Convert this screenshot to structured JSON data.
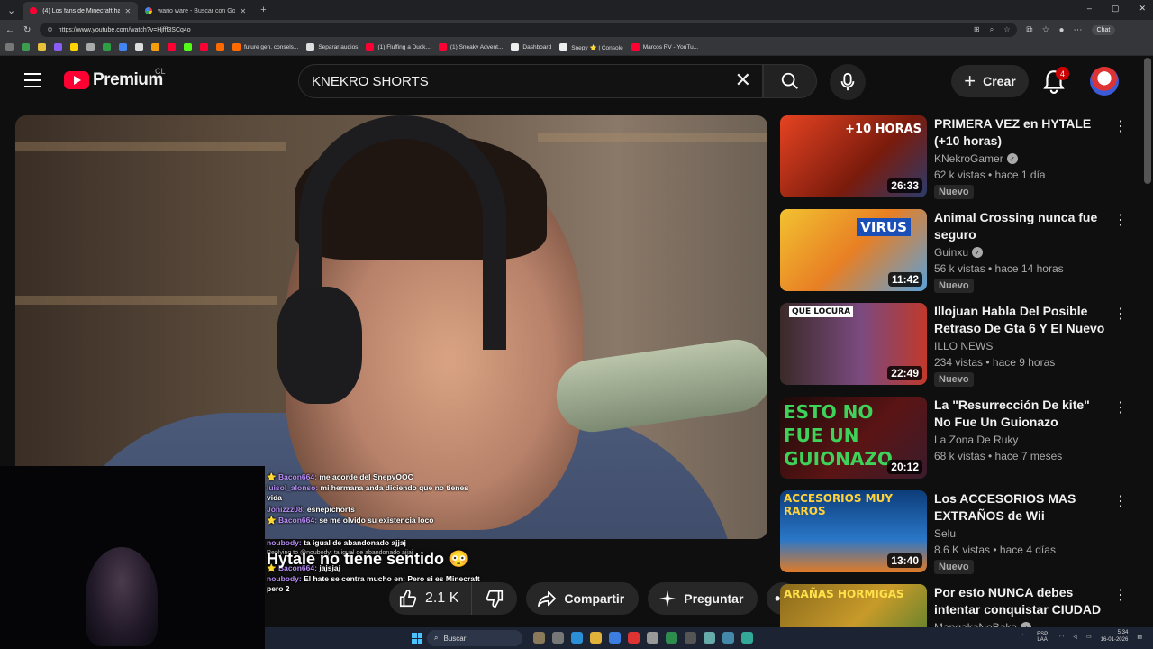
{
  "browser": {
    "tabs": [
      {
        "title": "(4) Los fans de Minecraft hateando",
        "active": true
      },
      {
        "title": "wario ware - Buscar con Google",
        "active": false
      }
    ],
    "url": "https://www.youtube.com/watch?v=Hjfff3SCq4o",
    "chat_label": "Chat",
    "bookmarks": [
      "future gen. consels...",
      "Separar audios",
      "(1) Fluffing a Duck...",
      "(1) Sneaky Advent...",
      "Dashboard",
      "Snepy ⭐ | Console",
      "Marcos RV - YouTu..."
    ]
  },
  "header": {
    "logo_text": "Premium",
    "country": "CL",
    "search_value": "KNEKRO SHORTS",
    "create_label": "Crear",
    "notification_count": "4"
  },
  "video": {
    "title": "Hytale no tiene sentido 😳",
    "like_count": "2.1 K",
    "share_label": "Compartir",
    "ask_label": "Preguntar"
  },
  "chat": [
    {
      "user": "Bacon664:",
      "text": "me acorde del SnepyOOC"
    },
    {
      "user": "luisol_alonso:",
      "text": "mi hermana anda diciendo que no tienes vida"
    },
    {
      "user": "Jonizzz08:",
      "text": "esnepichorts"
    },
    {
      "user": "Bacon664:",
      "text": "se me olvido su existencia loco"
    },
    {
      "user": "noubody:",
      "text": "ta igual de abandonado ajjaj"
    },
    {
      "user": "Replying to @noubody:",
      "text": "ta igual de abandonado ajjaj"
    },
    {
      "user": "Bacon664:",
      "text": "jajsjaj"
    },
    {
      "user": "noubody:",
      "text": "El hate se centra mucho en: Pero si es Minecraft pero 2"
    }
  ],
  "recommendations": [
    {
      "title": "PRIMERA VEZ en HYTALE (+10 horas)",
      "channel": "KNekroGamer",
      "verified": true,
      "stats": "62 k vistas • hace 1 día",
      "badge": "Nuevo",
      "duration": "26:33",
      "thumb_text": "+10 HORAS",
      "thumb_color": "#c23a1b"
    },
    {
      "title": "Animal Crossing nunca fue seguro",
      "channel": "Guinxu",
      "verified": true,
      "stats": "56 k vistas • hace 14 horas",
      "badge": "Nuevo",
      "duration": "11:42",
      "thumb_text": "VIRUS",
      "thumb_color": "#d9a82a"
    },
    {
      "title": "Illojuan Habla Del Posible Retraso De Gta 6 Y El Nuevo ...",
      "channel": "ILLO NEWS",
      "verified": false,
      "stats": "234 vistas • hace 9 horas",
      "badge": "Nuevo",
      "duration": "22:49",
      "thumb_text": "QUE LOCURA",
      "thumb_color": "#6a3b6e"
    },
    {
      "title": "La \"Resurrección De kite\" No Fue Un Guionazo (Explicación ...",
      "channel": "La Zona De Ruky",
      "verified": false,
      "stats": "68 k vistas • hace 7 meses",
      "badge": "",
      "duration": "20:12",
      "thumb_text": "ESTO NO FUE UN GUIONAZO",
      "thumb_color": "#2a1010"
    },
    {
      "title": "Los ACCESORIOS MAS EXTRAÑOS de Wii",
      "channel": "Selu",
      "verified": false,
      "stats": "8.6 K vistas • hace 4 días",
      "badge": "Nuevo",
      "duration": "13:40",
      "thumb_text": "ACCESORIOS MUY RAROS",
      "thumb_color": "#1d5fa8"
    },
    {
      "title": "Por esto NUNCA debes intentar conquistar CIUDAD METEORO ...",
      "channel": "MangakaNoBaka",
      "verified": true,
      "stats": "",
      "badge": "",
      "duration": "",
      "thumb_text": "ARAÑAS HORMIGAS",
      "thumb_color": "#7a5a20"
    }
  ],
  "taskbar": {
    "search_placeholder": "Buscar",
    "lang": "ESP LAA",
    "time": "5:34",
    "date": "16-01-2026"
  }
}
